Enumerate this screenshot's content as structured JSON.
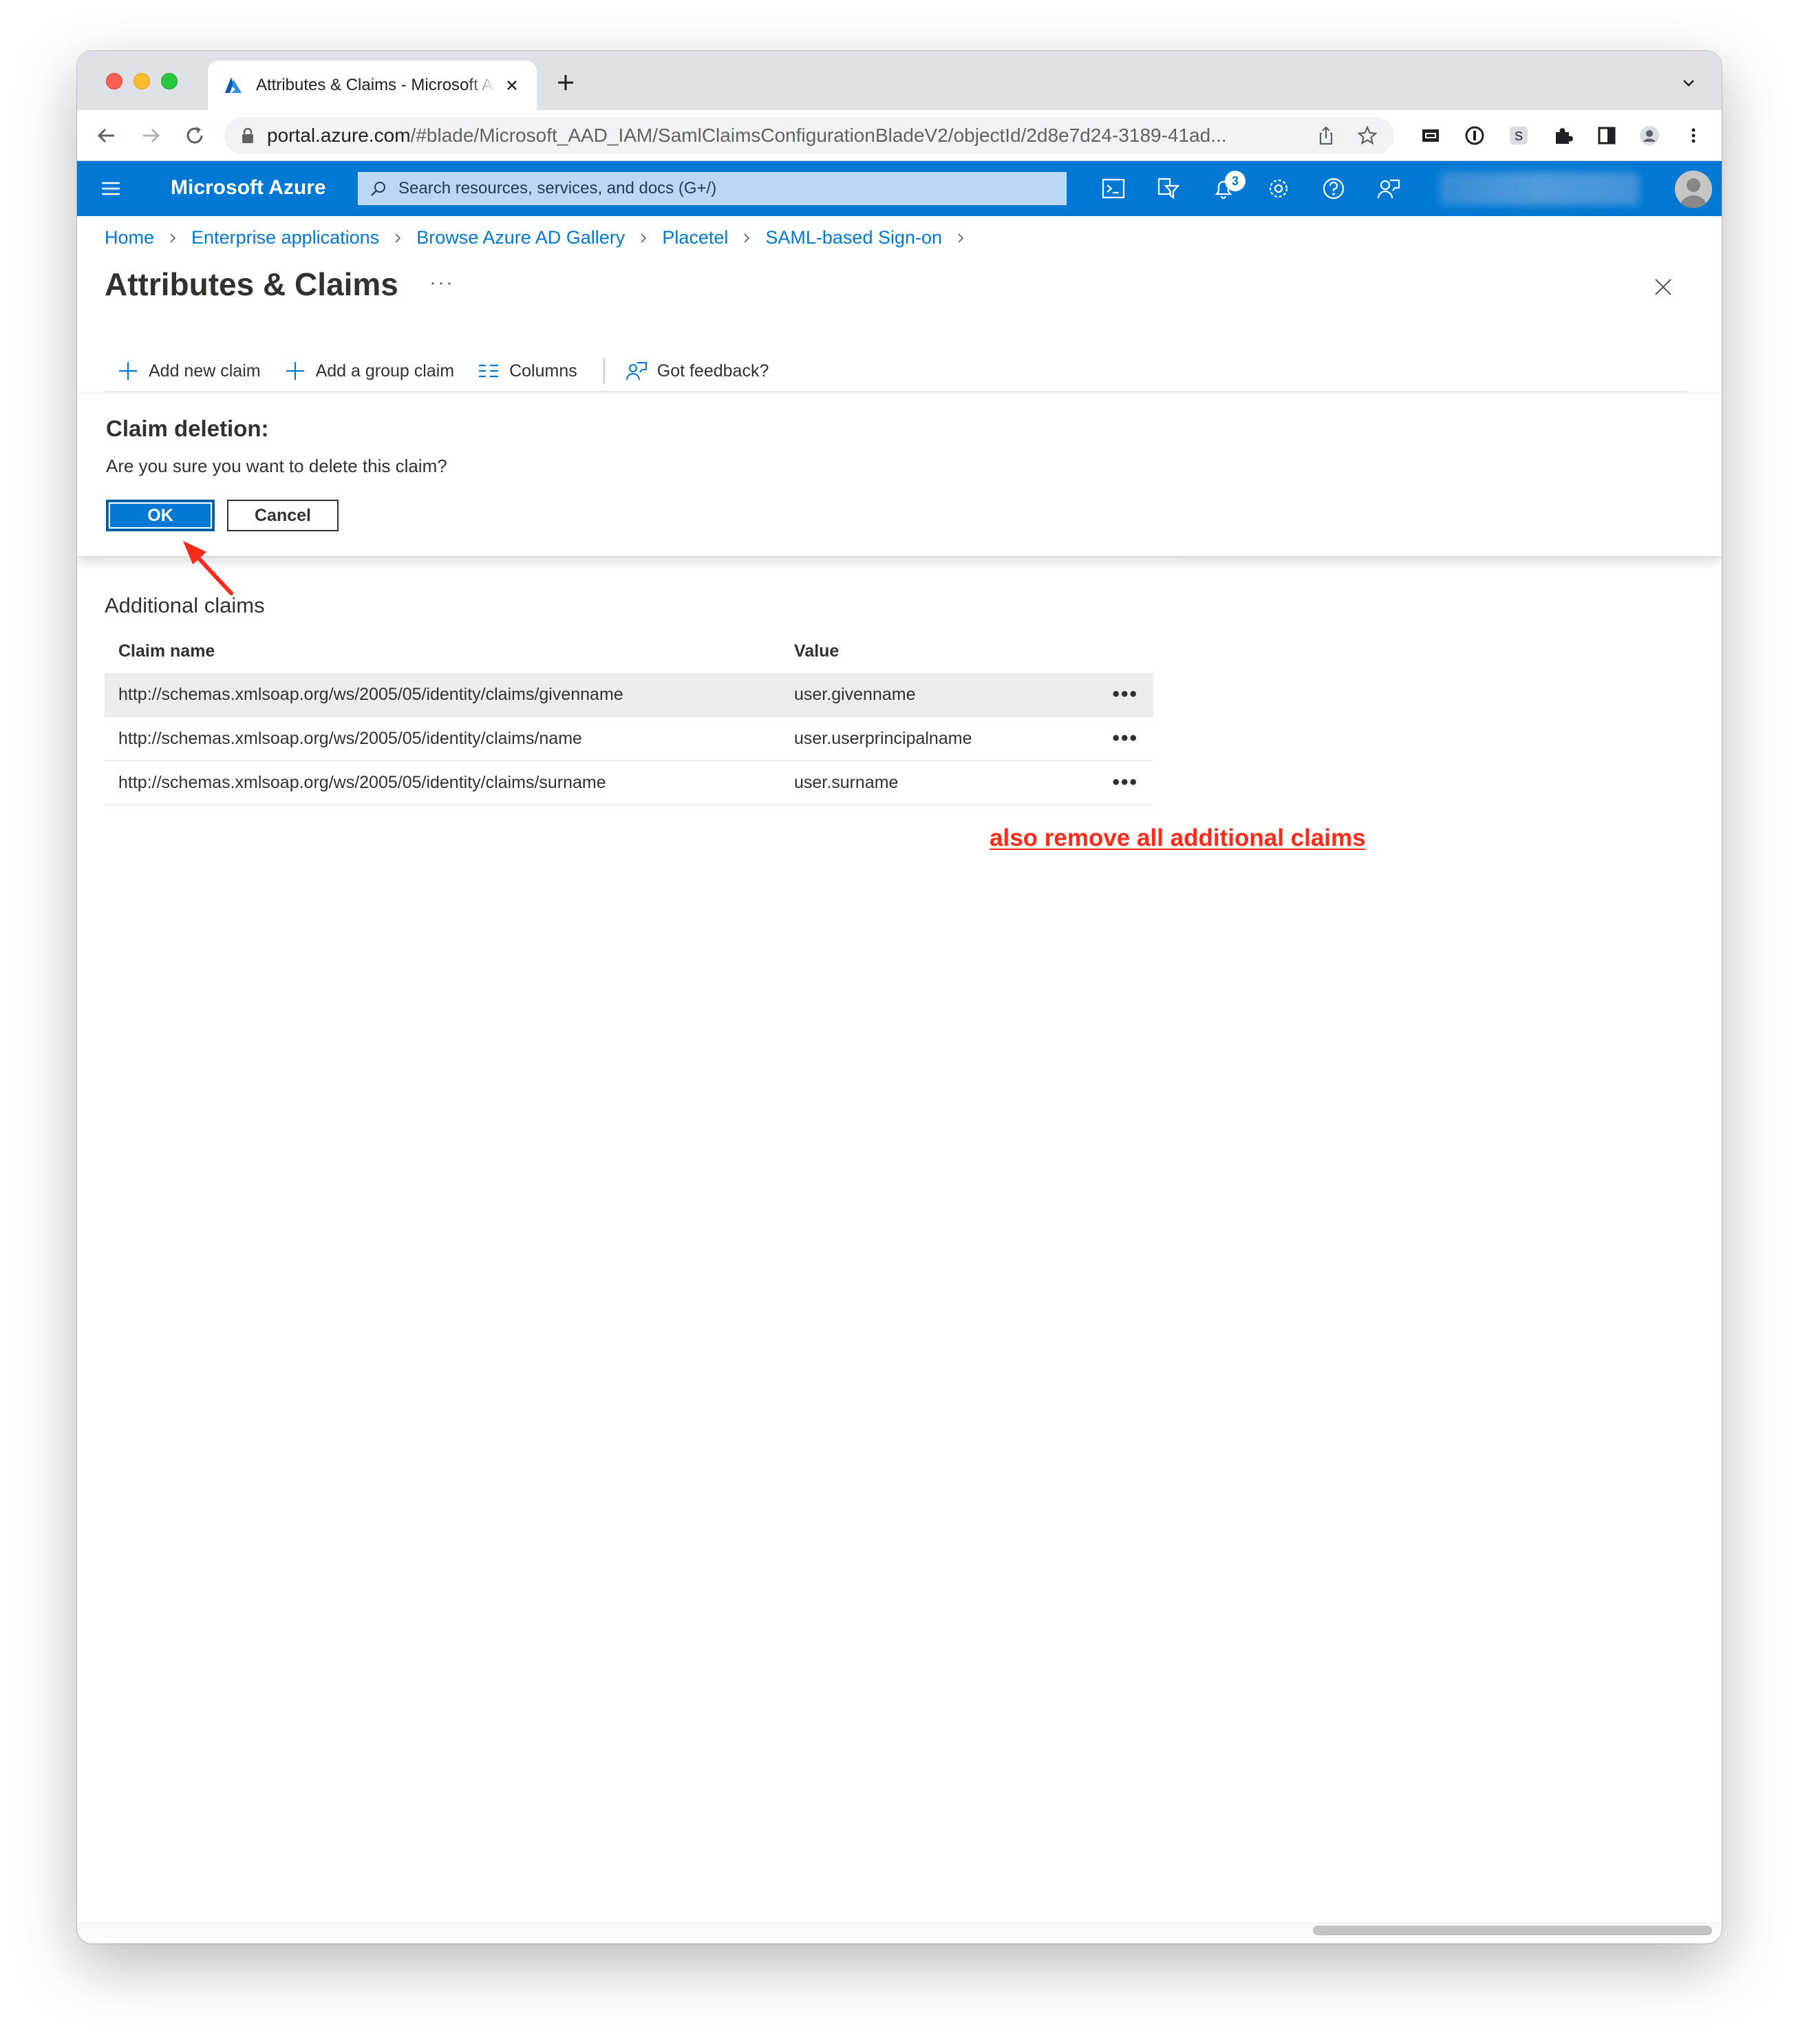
{
  "browser": {
    "tab_title": "Attributes & Claims - Microsoft Azure",
    "url_host": "portal.azure.com",
    "url_path": "/#blade/Microsoft_AAD_IAM/SamlClaimsConfigurationBladeV2/objectId/2d8e7d24-3189-41ad..."
  },
  "azure": {
    "brand": "Microsoft Azure",
    "search_placeholder": "Search resources, services, and docs (G+/)",
    "notification_count": "3"
  },
  "breadcrumb": [
    "Home",
    "Enterprise applications",
    "Browse Azure AD Gallery",
    "Placetel",
    "SAML-based Sign-on"
  ],
  "page": {
    "title": "Attributes & Claims",
    "more": "···"
  },
  "commands": {
    "add_new_claim": "Add new claim",
    "add_group_claim": "Add a group claim",
    "columns": "Columns",
    "feedback": "Got feedback?"
  },
  "dialog": {
    "title": "Claim deletion:",
    "message": "Are you sure you want to delete this claim?",
    "ok": "OK",
    "cancel": "Cancel"
  },
  "additional_claims": {
    "heading": "Additional claims",
    "col_name": "Claim name",
    "col_value": "Value",
    "rows": [
      {
        "name": "http://schemas.xmlsoap.org/ws/2005/05/identity/claims/givenname",
        "value": "user.givenname",
        "more": "•••"
      },
      {
        "name": "http://schemas.xmlsoap.org/ws/2005/05/identity/claims/name",
        "value": "user.userprincipalname",
        "more": "•••"
      },
      {
        "name": "http://schemas.xmlsoap.org/ws/2005/05/identity/claims/surname",
        "value": "user.surname",
        "more": "•••"
      }
    ]
  },
  "annotation": {
    "note": "also remove all additional claims",
    "color": "#ff2a1a"
  },
  "colors": {
    "azure_blue": "#0078d4",
    "selected_row": "#ededed"
  }
}
